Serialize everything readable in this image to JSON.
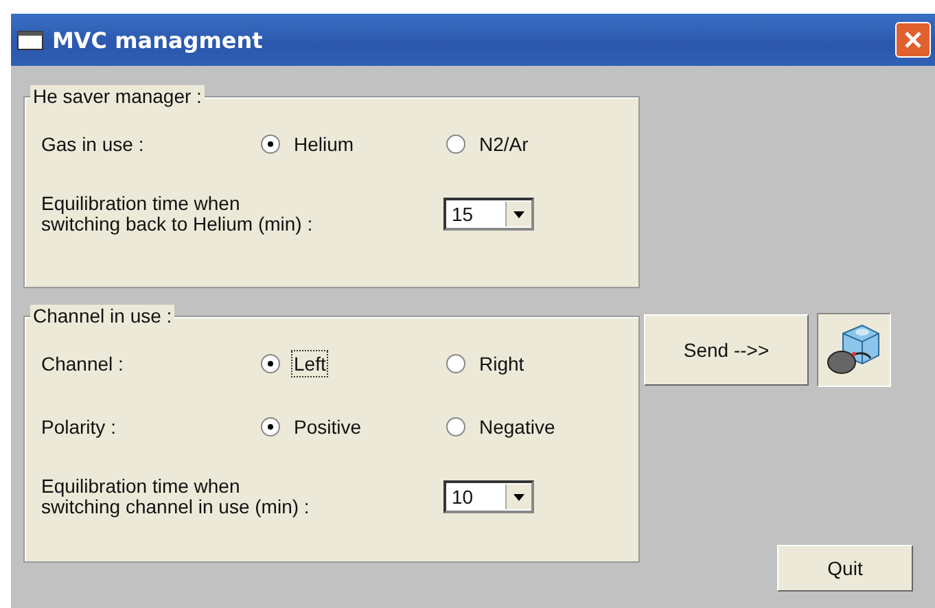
{
  "window": {
    "title": "MVC managment"
  },
  "groups": [
    {
      "title": "He saver manager :",
      "rows": [
        {
          "kind": "radio",
          "label": "Gas in use :",
          "options": [
            {
              "label": "Helium",
              "selected": true,
              "focused": false
            },
            {
              "label": "N2/Ar",
              "selected": false,
              "focused": false
            }
          ]
        },
        {
          "kind": "dropdown",
          "label_lines": [
            "Equilibration time when",
            "switching back to Helium (min) :"
          ],
          "value": "15"
        }
      ]
    },
    {
      "title": "Channel in use :",
      "rows": [
        {
          "kind": "radio",
          "label": "Channel :",
          "options": [
            {
              "label": "Left",
              "selected": true,
              "focused": true
            },
            {
              "label": "Right",
              "selected": false,
              "focused": false
            }
          ]
        },
        {
          "kind": "radio",
          "label": "Polarity :",
          "options": [
            {
              "label": "Positive",
              "selected": true,
              "focused": false
            },
            {
              "label": "Negative",
              "selected": false,
              "focused": false
            }
          ]
        },
        {
          "kind": "dropdown",
          "label_lines": [
            "Equilibration time when",
            "switching channel in use (min) :"
          ],
          "value": "10"
        }
      ]
    }
  ],
  "send_button": "Send -->>",
  "quit_button": "Quit"
}
